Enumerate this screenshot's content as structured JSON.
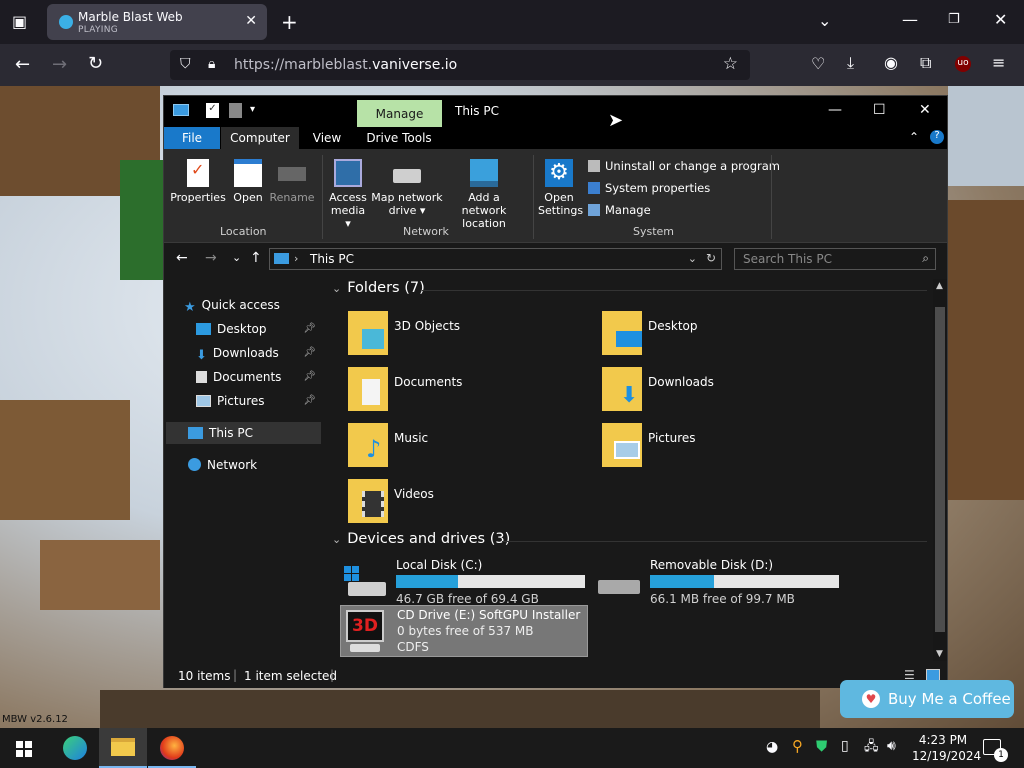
{
  "browser": {
    "tab_title": "Marble Blast Web",
    "tab_status": "PLAYING",
    "url_prefix": "https://marbleblast.",
    "url_domain": "vaniverse.io"
  },
  "explorer": {
    "title": "This PC",
    "context_tab": "Manage",
    "menu": {
      "file": "File",
      "computer": "Computer",
      "view": "View",
      "drive_tools": "Drive Tools"
    },
    "ribbon": {
      "location": {
        "label": "Location",
        "properties": "Properties",
        "open": "Open",
        "rename": "Rename"
      },
      "network": {
        "label": "Network",
        "access_media_1": "Access",
        "access_media_2": "media",
        "map_drive_1": "Map network",
        "map_drive_2": "drive",
        "add_location_1": "Add a network",
        "add_location_2": "location"
      },
      "system": {
        "label": "System",
        "open_settings_1": "Open",
        "open_settings_2": "Settings",
        "uninstall": "Uninstall or change a program",
        "properties": "System properties",
        "manage": "Manage"
      }
    },
    "address": {
      "path": "This PC",
      "search_placeholder": "Search This PC"
    },
    "nav": {
      "quick_access": "Quick access",
      "desktop": "Desktop",
      "downloads": "Downloads",
      "documents": "Documents",
      "pictures": "Pictures",
      "this_pc": "This PC",
      "network": "Network"
    },
    "folders_header": "Folders (7)",
    "folders": [
      "3D Objects",
      "Desktop",
      "Documents",
      "Downloads",
      "Music",
      "Pictures",
      "Videos"
    ],
    "drives_header": "Devices and drives (3)",
    "drives": [
      {
        "name": "Local Disk (C:)",
        "space": "46.7 GB free of 69.4 GB",
        "used_fraction": 0.33
      },
      {
        "name": "Removable Disk (D:)",
        "space": "66.1 MB free of 99.7 MB",
        "used_fraction": 0.34
      },
      {
        "name": "CD Drive (E:) SoftGPU Installer",
        "space": "0 bytes free of 537 MB",
        "fs": "CDFS"
      }
    ],
    "status": {
      "items": "10 items",
      "selected": "1 item selected"
    }
  },
  "overlay": {
    "coffee": "Buy Me a Coffee",
    "version": "MBW v2.6.12"
  },
  "taskbar": {
    "time": "4:23 PM",
    "date": "12/19/2024",
    "notifications": "1"
  }
}
